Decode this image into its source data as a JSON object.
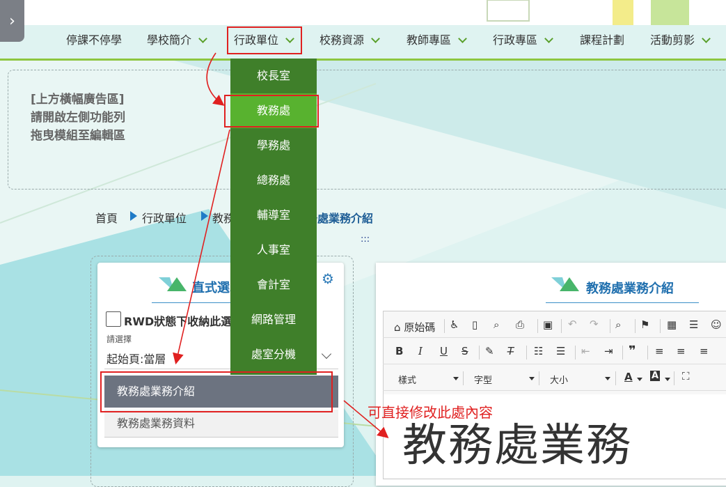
{
  "colors": {
    "nav_accent": "#8dc63f",
    "menu_bg": "#3f7f2a",
    "menu_active": "#58b22f",
    "annotation": "#e02020",
    "title_blue": "#1f6fae"
  },
  "side_toggle": {
    "icon": "chevron-right-icon",
    "glyph": "›"
  },
  "nav": {
    "items": [
      {
        "label": "停課不停學",
        "has_submenu": false
      },
      {
        "label": "學校簡介",
        "has_submenu": true
      },
      {
        "label": "行政單位",
        "has_submenu": true
      },
      {
        "label": "校務資源",
        "has_submenu": true
      },
      {
        "label": "教師專區",
        "has_submenu": true
      },
      {
        "label": "行政專區",
        "has_submenu": true
      },
      {
        "label": "課程計劃",
        "has_submenu": false
      },
      {
        "label": "活動剪影",
        "has_submenu": true
      }
    ]
  },
  "dropdown": {
    "items": [
      "校長室",
      "教務處",
      "學務處",
      "總務處",
      "輔導室",
      "人事室",
      "會計室",
      "網路管理",
      "處室分機"
    ],
    "active": "教務處"
  },
  "ad": {
    "lines": [
      "[上方橫幅廣告區]",
      "請開啟左側功能列",
      "拖曳模組至編輯區"
    ]
  },
  "breadcrumb": {
    "home": "首頁",
    "level1": "行政單位",
    "level2": "教務處",
    "current": "教務處業務介紹"
  },
  "separator_text": ":::",
  "left_module": {
    "title": "直式選單",
    "checkbox_label": "RWD狀態下收納此選單",
    "select_label": "請選擇",
    "select_value": "起始頁:當層",
    "options": [
      {
        "label": "教務處業務介紹",
        "active": true
      },
      {
        "label": "教務處業務資料",
        "active": false
      }
    ]
  },
  "right_module": {
    "title": "教務處業務介紹",
    "toolbar": {
      "source_label": "原始碼",
      "style_label": "樣式",
      "font_label": "字型",
      "size_label": "大小"
    },
    "content_text": "教務處業務"
  },
  "annotation": {
    "note": "可直接修改此處內容"
  }
}
